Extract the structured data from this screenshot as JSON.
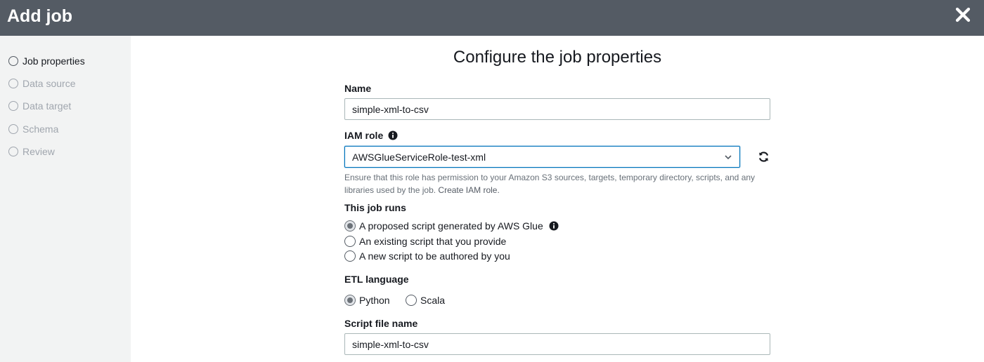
{
  "window": {
    "title": "Add job"
  },
  "sidebar": {
    "steps": [
      {
        "label": "Job properties",
        "state": "active"
      },
      {
        "label": "Data source",
        "state": "pending"
      },
      {
        "label": "Data target",
        "state": "pending"
      },
      {
        "label": "Schema",
        "state": "pending"
      },
      {
        "label": "Review",
        "state": "pending"
      }
    ]
  },
  "main": {
    "title": "Configure the job properties",
    "name": {
      "label": "Name",
      "value": "simple-xml-to-csv"
    },
    "iam_role": {
      "label": "IAM role",
      "value": "AWSGlueServiceRole-test-xml",
      "help_text": "Ensure that this role has permission to your Amazon S3 sources, targets, temporary directory, scripts, and any libraries used by the job.",
      "help_link": "Create IAM role."
    },
    "job_runs": {
      "label": "This job runs",
      "options": [
        {
          "label": "A proposed script generated by AWS Glue",
          "selected": true
        },
        {
          "label": "An existing script that you provide",
          "selected": false
        },
        {
          "label": "A new script to be authored by you",
          "selected": false
        }
      ]
    },
    "etl_language": {
      "label": "ETL language",
      "options": [
        {
          "label": "Python",
          "selected": true
        },
        {
          "label": "Scala",
          "selected": false
        }
      ]
    },
    "script_file_name": {
      "label": "Script file name",
      "value": "simple-xml-to-csv"
    }
  },
  "icons": {
    "close": "close-icon",
    "info": "info-icon",
    "refresh": "refresh-icon",
    "chevron": "chevron-down-icon"
  },
  "colors": {
    "header_bg": "#545b64",
    "sidebar_bg": "#f2f3f3",
    "focus_border": "#0073bb"
  }
}
